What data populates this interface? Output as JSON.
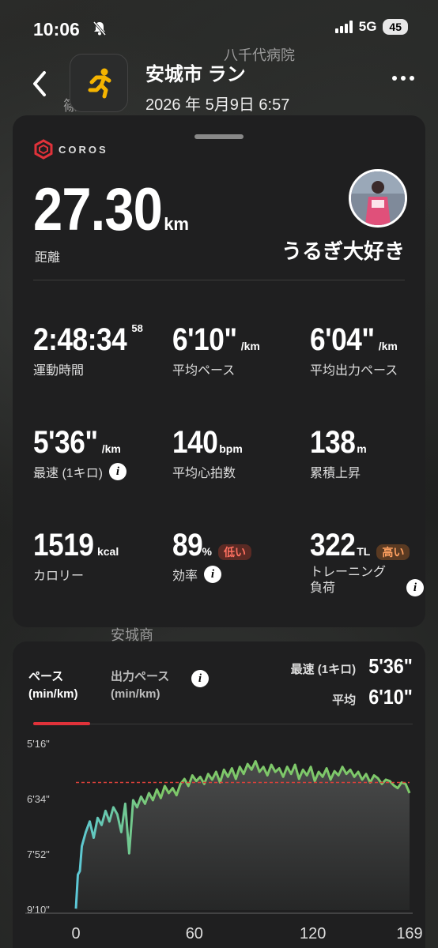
{
  "status_bar": {
    "time": "10:06",
    "network": "5G",
    "battery": "45"
  },
  "map_labels": [
    "八千代病院",
    "篠目中",
    "安城商"
  ],
  "header": {
    "title": "安城市 ラン",
    "date": "2026 年 5月9日 6:57"
  },
  "brand": "COROS",
  "summary": {
    "distance_value": "27.30",
    "distance_unit": "km",
    "distance_label": "距離",
    "username": "うるぎ大好き"
  },
  "stats": [
    {
      "value": "2:48:34",
      "sup": "58",
      "unit": "",
      "label": "運動時間"
    },
    {
      "value": "6'10\"",
      "unit": "/km",
      "label": "平均ペース"
    },
    {
      "value": "6'04\"",
      "unit": "/km",
      "label": "平均出力ペース"
    },
    {
      "value": "5'36\"",
      "unit": "/km",
      "label": "最速 (1キロ)",
      "info": true
    },
    {
      "value": "140",
      "unit": "bpm",
      "label": "平均心拍数"
    },
    {
      "value": "138",
      "unit": "m",
      "label": "累積上昇"
    },
    {
      "value": "1519",
      "unit": "kcal",
      "label": "カロリー"
    },
    {
      "value": "89",
      "unit": "%",
      "label": "効率",
      "info": true,
      "badge": "低い",
      "badge_type": "low"
    },
    {
      "value": "322",
      "unit": "TL",
      "label": "トレーニング\n負荷",
      "info": true,
      "badge": "高い",
      "badge_type": "high"
    }
  ],
  "chart_tabs": {
    "pace": "ペース\n(min/km)",
    "power_pace": "出力ペース\n(min/km)"
  },
  "chart_summary": {
    "fastest_label": "最速 (1キロ)",
    "fastest_value": "5'36\"",
    "avg_label": "平均",
    "avg_value": "6'10\""
  },
  "colors": {
    "accent_red": "#e0323a",
    "line_green": "#7ec86a",
    "line_cyan": "#5cc8d8",
    "avg_line": "#d9403a"
  },
  "chart_data": {
    "type": "line",
    "x_label": "",
    "y_label": "",
    "x_ticks": [
      "0",
      "60",
      "120",
      "169"
    ],
    "y_ticks": [
      "5'16\"",
      "6'34\"",
      "7'52\"",
      "9'10\""
    ],
    "x_range": [
      0,
      169
    ],
    "y_range_sec": [
      316,
      550
    ],
    "avg_sec": 370,
    "series": [
      {
        "x": [
          0,
          1,
          2,
          3,
          5,
          7,
          9,
          11,
          13,
          15,
          17,
          19,
          21,
          23,
          25,
          27,
          29,
          31,
          33,
          35,
          37,
          39,
          41,
          43,
          45,
          47,
          49,
          51,
          53,
          55,
          57,
          59,
          61,
          63,
          65,
          67,
          69,
          71,
          73,
          75,
          77,
          79,
          81,
          83,
          85,
          87,
          89,
          91,
          93,
          95,
          97,
          99,
          101,
          103,
          105,
          107,
          109,
          111,
          113,
          115,
          117,
          119,
          121,
          123,
          125,
          127,
          129,
          131,
          133,
          135,
          137,
          139,
          141,
          143,
          145,
          147,
          149,
          151,
          153,
          155,
          157,
          159,
          161,
          163,
          165,
          167,
          169
        ],
        "pace_sec": [
          548,
          500,
          495,
          460,
          440,
          425,
          448,
          420,
          430,
          410,
          425,
          405,
          415,
          440,
          400,
          470,
          395,
          405,
          390,
          400,
          385,
          395,
          380,
          392,
          375,
          385,
          378,
          388,
          372,
          365,
          375,
          360,
          368,
          362,
          372,
          358,
          366,
          355,
          370,
          352,
          362,
          350,
          365,
          348,
          358,
          344,
          352,
          340,
          355,
          348,
          360,
          345,
          355,
          350,
          362,
          348,
          358,
          345,
          365,
          352,
          360,
          348,
          368,
          355,
          362,
          350,
          366,
          354,
          360,
          348,
          358,
          352,
          362,
          355,
          366,
          358,
          370,
          360,
          364,
          372,
          366,
          368,
          374,
          378,
          370,
          372,
          385
        ]
      }
    ]
  }
}
